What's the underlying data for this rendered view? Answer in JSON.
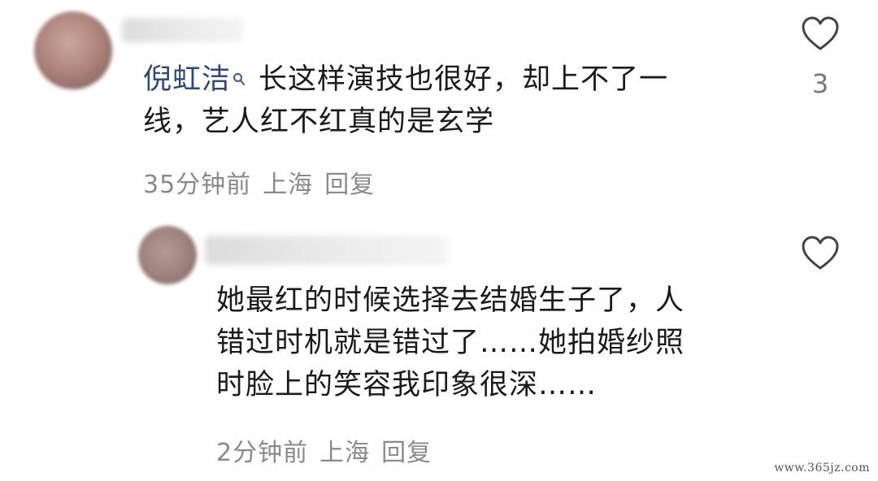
{
  "comment1": {
    "author": "倪虹洁",
    "author_icon": "search-icon",
    "text_line1": "长这样演技也很好，却上不了一",
    "text_line2": "线，艺人红不红真的是玄学",
    "time": "35分钟前",
    "location": "上海",
    "reply": "回复",
    "likes": "3"
  },
  "comment2": {
    "text_line1": "她最红的时候选择去结婚生子了，人",
    "text_line2": "错过时机就是错过了……她拍婚纱照",
    "text_line3": "时脸上的笑容我印象很深……",
    "time": "2分钟前",
    "location": "上海",
    "reply": "回复"
  },
  "watermark": "www.365jz.com",
  "colors": {
    "author": "#2b4a7a",
    "meta": "#8a8a8a",
    "text": "#1a1a1a"
  }
}
